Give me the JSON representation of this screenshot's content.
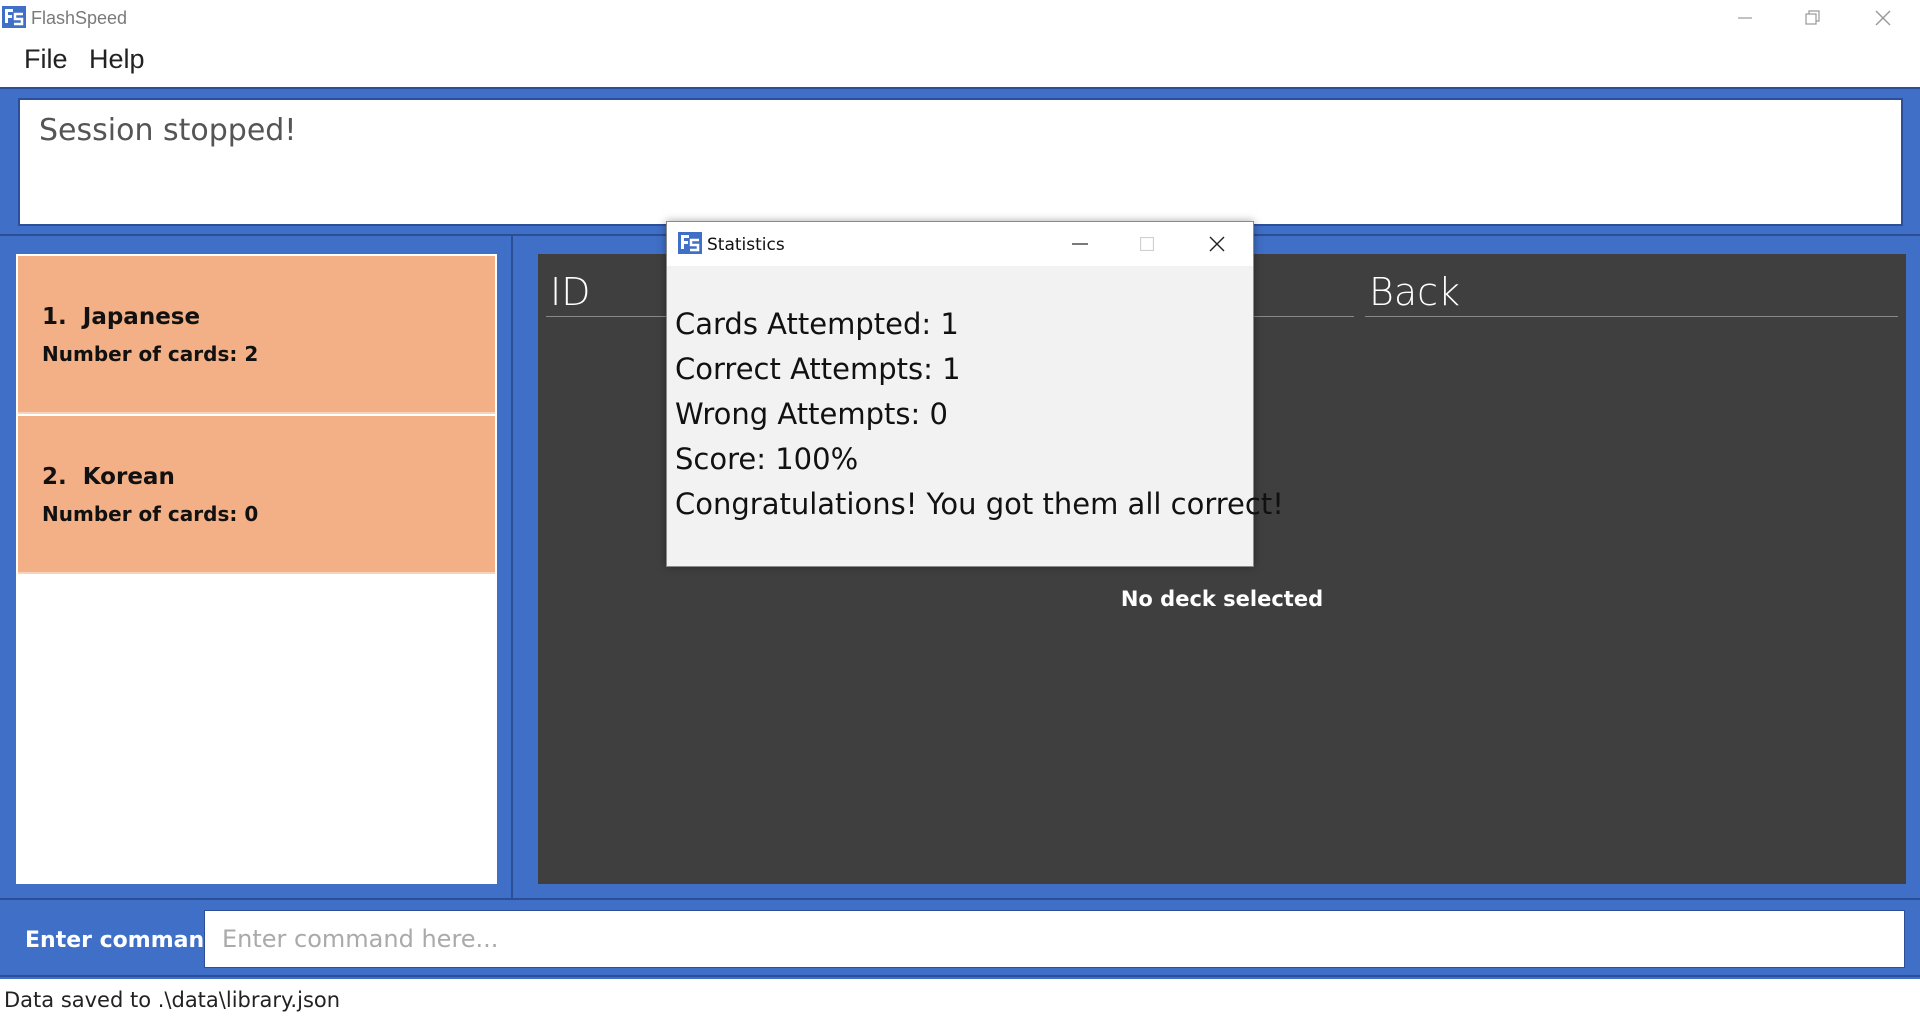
{
  "window": {
    "title": "FlashSpeed",
    "icon": "flashspeed-app-icon"
  },
  "menu": {
    "file_label": "File",
    "help_label": "Help"
  },
  "result_display": {
    "text": "Session stopped!"
  },
  "decks": [
    {
      "index": "1.",
      "name": "Japanese",
      "card_count_text": "Number of cards: 2"
    },
    {
      "index": "2.",
      "name": "Korean",
      "card_count_text": "Number of cards: 0"
    }
  ],
  "card_table": {
    "columns": [
      "ID",
      "Back"
    ],
    "empty_message": "No deck selected"
  },
  "command": {
    "label": "Enter command:",
    "placeholder": "Enter command here...",
    "value": ""
  },
  "status_bar": {
    "text": "Data saved to .\\data\\library.json"
  },
  "statistics_dialog": {
    "title": "Statistics",
    "lines": [
      "Cards Attempted: 1",
      "Correct Attempts: 1",
      "Wrong Attempts: 0",
      "Score: 100%",
      "Congratulations! You got them all correct!"
    ]
  },
  "colors": {
    "frame_blue": "#3f6fc6",
    "deck_card": "#f3b087",
    "card_panel": "#3f3f3f",
    "dialog_bg": "#f2f2f2"
  }
}
